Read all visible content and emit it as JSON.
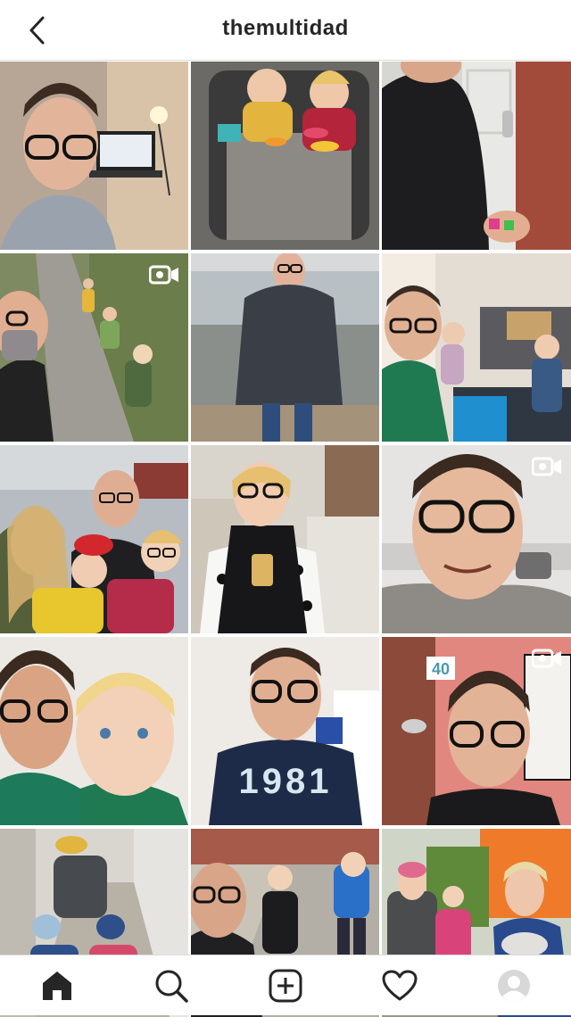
{
  "header": {
    "username": "themultidad",
    "back_icon": "chevron-left-icon"
  },
  "posts": [
    {
      "scene": "selfie-man-glasses-desk-laptop",
      "is_video": false
    },
    {
      "scene": "kids-in-stroller-with-toys",
      "is_video": false
    },
    {
      "scene": "man-at-front-door-holding-toy",
      "is_video": false
    },
    {
      "scene": "man-with-mask-kids-on-garden-path",
      "is_video": true
    },
    {
      "scene": "man-in-grey-jacket-on-beach",
      "is_video": false
    },
    {
      "scene": "man-and-kids-at-home-desk",
      "is_video": false
    },
    {
      "scene": "family-selfie-outdoors",
      "is_video": false
    },
    {
      "scene": "girl-with-glasses-drinking-juice",
      "is_video": false
    },
    {
      "scene": "selfie-man-glasses-kitchen",
      "is_video": true
    },
    {
      "scene": "man-kissing-blond-boy",
      "is_video": false
    },
    {
      "scene": "man-in-navy-1981-tshirt",
      "is_video": false
    },
    {
      "scene": "man-selfie-pink-wall-40-sign",
      "is_video": true
    },
    {
      "scene": "kids-on-ride-on-cars-in-alley",
      "is_video": false
    },
    {
      "scene": "man-and-kids-street-selfie",
      "is_video": false
    },
    {
      "scene": "grandmother-with-kids-and-cat",
      "is_video": false
    }
  ],
  "post_overlay_texts": {
    "balloon_number": "40",
    "tshirt_print": "1981"
  },
  "navbar": {
    "items": [
      "home-icon",
      "search-icon",
      "new-post-icon",
      "heart-icon",
      "profile-avatar"
    ]
  },
  "colors": {
    "text": "#262626",
    "border": "#dbdbdb",
    "background": "#ffffff"
  }
}
